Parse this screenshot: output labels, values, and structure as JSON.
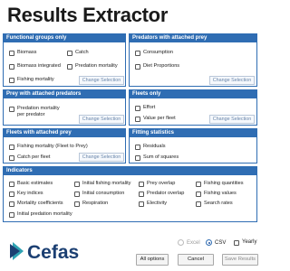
{
  "window": {
    "title": "Results Extractor"
  },
  "panels": {
    "functional_groups": {
      "header": "Functional groups only",
      "biomass": "Biomass",
      "catch": "Catch",
      "biomass_integrated": "Biomass integrated",
      "predation_mortality": "Predation mortality",
      "fishing_mortality": "Fishing mortality",
      "change_selection": "Change Selection"
    },
    "predators_prey": {
      "header": "Predators with attached prey",
      "consumption": "Consumption",
      "diet_proportions": "Diet Proportions",
      "change_selection": "Change Selection"
    },
    "prey_predators": {
      "header": "Prey with attached predators",
      "predation_mortality_line1": "Predation mortality",
      "predation_mortality_line2": "per predator",
      "change_selection": "Change Selection"
    },
    "fleets_only": {
      "header": "Fleets only",
      "effort": "Effort",
      "value_per_fleet": "Value per fleet",
      "change_selection": "Change Selection"
    },
    "fleets_prey": {
      "header": "Fleets with attached prey",
      "fishing_mortality_fleet": "Fishing mortality (Fleet to Prey)",
      "catch_per_fleet": "Catch per fleet",
      "change_selection": "Change Selection"
    },
    "fitting": {
      "header": "Fitting statistics",
      "residuals": "Residuals",
      "sum_of_squares": "Sum of squares"
    },
    "indicators": {
      "header": "Indicators",
      "basic_estimates": "Basic estimates",
      "key_indices": "Key indices",
      "mortality_coefficients": "Mortality coefficients",
      "initial_predation_mortality": "Initial predation mortality",
      "initial_fishing_mortality": "Initial fishing mortality",
      "initial_consumption": "Initial consumption",
      "respiration": "Respiration",
      "prey_overlap": "Prey overlap",
      "predator_overlap": "Predator overlap",
      "electivity": "Electivity",
      "fishing_quantities": "Fishing quantities",
      "fishing_values": "Fishing values",
      "search_rates": "Search rates"
    }
  },
  "footer": {
    "logo_text": "Cefas",
    "format_excel": "Excel",
    "format_csv": "CSV",
    "yearly": "Yearly",
    "selected_format": "CSV",
    "all_options": "All options",
    "cancel": "Cancel",
    "save_results": "Save Results"
  },
  "colors": {
    "panel_blue": "#2f6db3",
    "logo_dark": "#1b3f72",
    "logo_teal": "#2fa3b3"
  }
}
